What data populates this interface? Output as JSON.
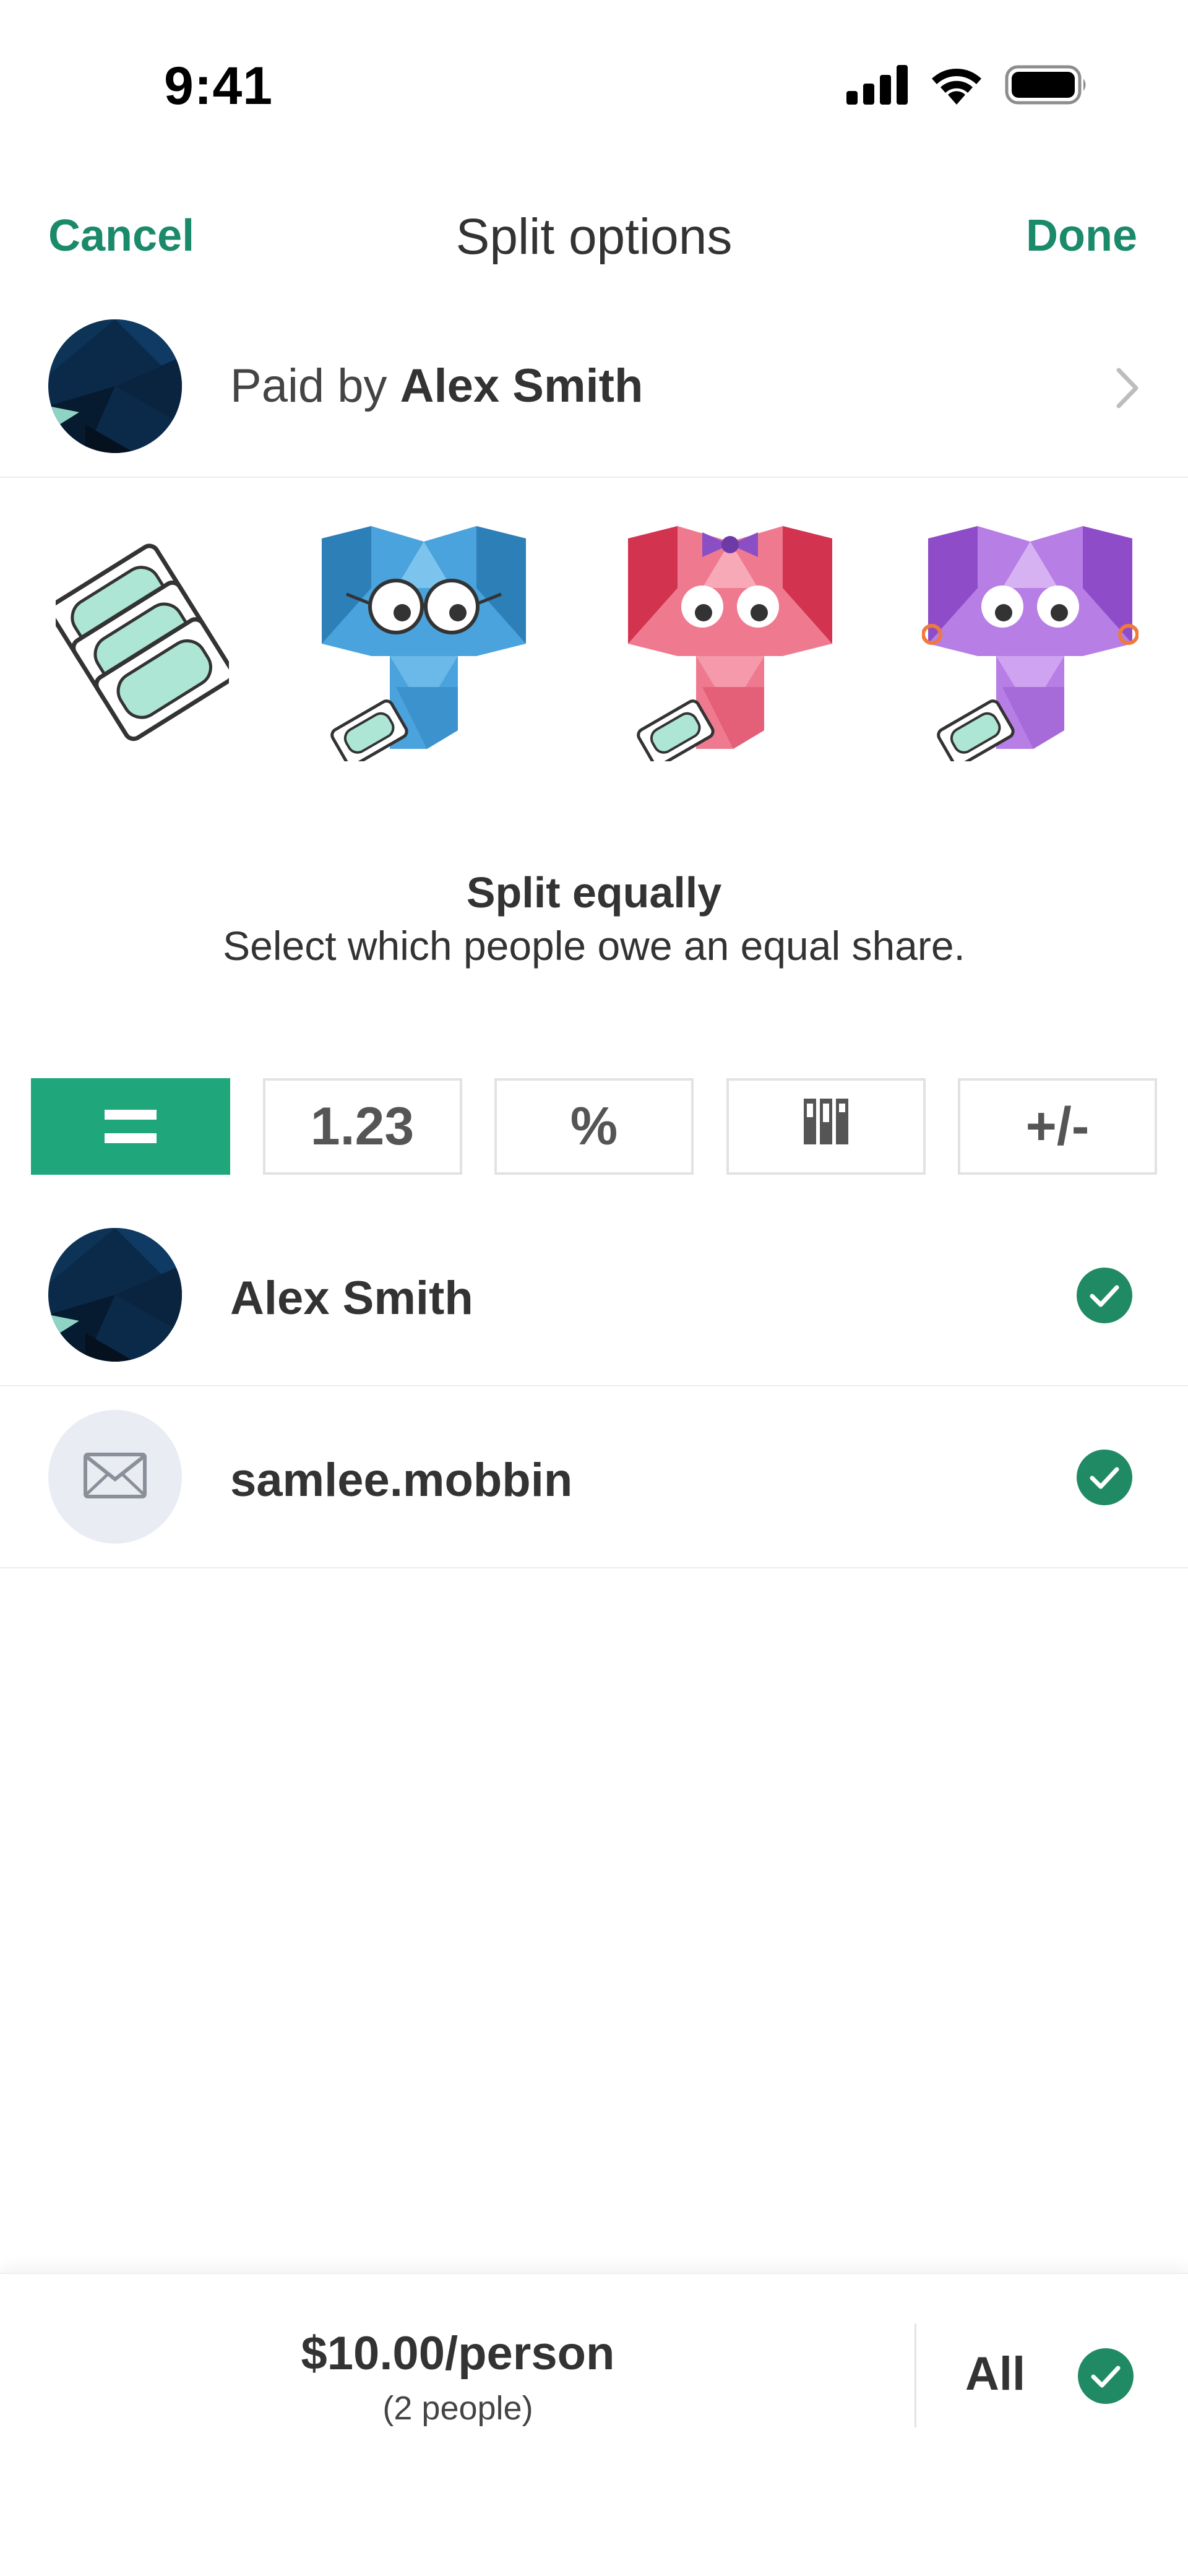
{
  "status_bar": {
    "time": "9:41",
    "icons": [
      "signal-icon",
      "wifi-icon",
      "battery-icon"
    ]
  },
  "nav": {
    "cancel_label": "Cancel",
    "title": "Split options",
    "done_label": "Done"
  },
  "paid_by": {
    "prefix": "Paid by ",
    "name": "Alex Smith"
  },
  "illustrations": [
    "bills-stack-icon",
    "blue-elephant-icon",
    "pink-elephant-icon",
    "purple-elephant-icon"
  ],
  "split": {
    "title": "Split equally",
    "description": "Select which people owe an equal share."
  },
  "tabs": [
    {
      "label": "=",
      "active": true
    },
    {
      "label": "1.23",
      "active": false
    },
    {
      "label": "%",
      "active": false
    },
    {
      "label": "",
      "icon": "shares-icon",
      "active": false
    },
    {
      "label": "+/-",
      "active": false
    }
  ],
  "people": [
    {
      "name": "Alex Smith",
      "checked": true
    },
    {
      "name": "samlee.mobbin",
      "checked": true
    }
  ],
  "summary": {
    "per_person": "$10.00/person",
    "people_count": "(2 people)",
    "all_label": "All",
    "all_checked": true
  },
  "colors": {
    "accent": "#1b8a6b",
    "tab_active": "#1fa67a",
    "check": "#1f8a64",
    "avatar_dark": "#0b2a4a"
  }
}
